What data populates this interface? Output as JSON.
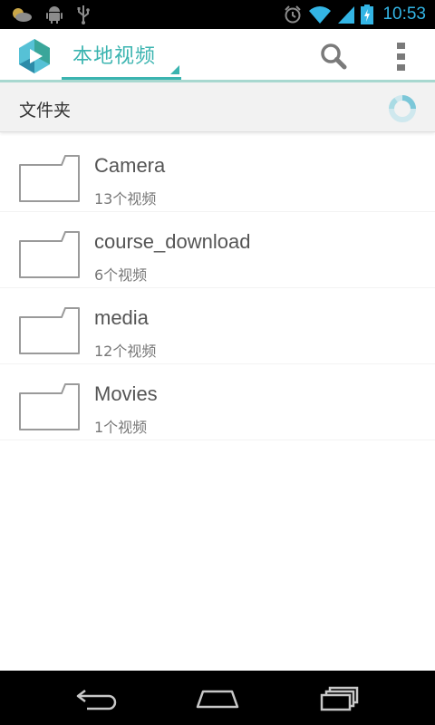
{
  "status_bar": {
    "time": "10:53",
    "icons": [
      "weather-icon",
      "android-debug-icon",
      "usb-icon",
      "alarm-icon",
      "wifi-icon",
      "cell-signal-icon",
      "battery-charging-icon"
    ],
    "accent_color": "#33b5e5"
  },
  "action_bar": {
    "title": "本地视频",
    "accent_color": "#3bb4b0",
    "icons": [
      "app-logo-icon",
      "search-icon",
      "overflow-menu-icon"
    ]
  },
  "folder_header": {
    "title": "文件夹"
  },
  "folders": [
    {
      "name": "Camera",
      "count": "13个视频"
    },
    {
      "name": "course_download",
      "count": "6个视频"
    },
    {
      "name": "media",
      "count": "12个视频"
    },
    {
      "name": "Movies",
      "count": "1个视频"
    }
  ],
  "nav_bar": {
    "icons": [
      "back-icon",
      "home-icon",
      "recent-apps-icon"
    ]
  }
}
